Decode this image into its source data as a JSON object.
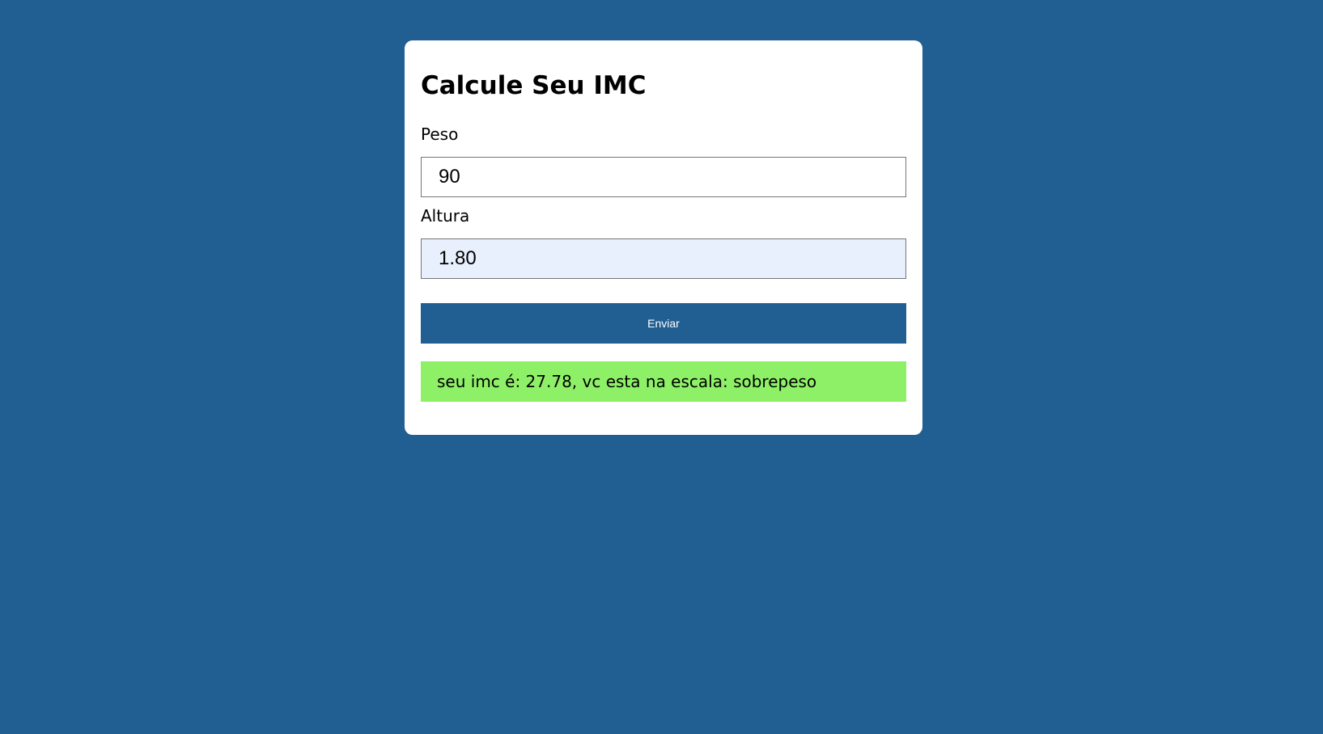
{
  "form": {
    "title": "Calcule Seu IMC",
    "peso_label": "Peso",
    "peso_value": "90",
    "altura_label": "Altura",
    "altura_value": "1.80",
    "submit_label": "Enviar"
  },
  "result": {
    "text": "seu imc é: 27.78, vc esta na escala: sobrepeso"
  },
  "colors": {
    "page_background": "#215f93",
    "card_background": "#ffffff",
    "button_background": "#215f93",
    "result_background": "#8ef067",
    "autofill_background": "#e8f0fe"
  }
}
